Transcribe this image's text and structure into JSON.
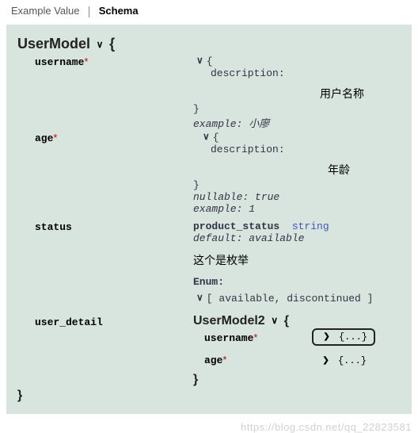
{
  "tabs": {
    "example_value": "Example Value",
    "schema": "Schema"
  },
  "model": {
    "name": "UserModel",
    "brace_open": "{",
    "brace_close": "}",
    "props": {
      "username": {
        "name": "username",
        "required": "*",
        "brace_open": "{",
        "brace_close": "}",
        "description_label": "description:",
        "description_value": "用户名称",
        "example_label": "example:",
        "example_value": "小廖"
      },
      "age": {
        "name": "age",
        "required": "*",
        "brace_open": "{",
        "brace_close": "}",
        "description_label": "description:",
        "description_value": "年龄",
        "nullable_label": "nullable:",
        "nullable_value": "true",
        "example_label": "example:",
        "example_value": "1"
      },
      "status": {
        "name": "status",
        "type_name": "product_status",
        "type_suffix": "string",
        "default_label": "default:",
        "default_value": "available",
        "note": "这个是枚举",
        "enum_label": "Enum:",
        "enum_open": "[",
        "enum_close": "]",
        "enum_items": "available, discontinued"
      },
      "user_detail": {
        "name": "user_detail",
        "ref_model": "UserModel2",
        "brace_open": "{",
        "brace_close": "}",
        "fields": {
          "username": {
            "name": "username",
            "required": "*",
            "collapsed": "{...}"
          },
          "age": {
            "name": "age",
            "required": "*",
            "collapsed": "{...}"
          }
        }
      }
    }
  },
  "watermark": "https://blog.csdn.net/qq_22823581"
}
